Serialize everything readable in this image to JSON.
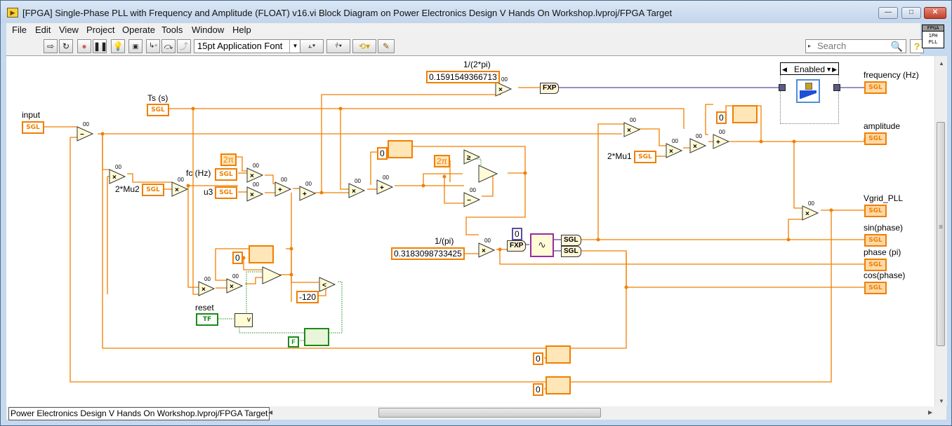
{
  "window": {
    "title": "[FPGA] Single-Phase PLL with Frequency and Amplitude (FLOAT) v16.vi Block Diagram on Power Electronics Design V Hands On Workshop.lvproj/FPGA Target",
    "buttons": {
      "minimize": "—",
      "maximize": "□",
      "close": "✕"
    }
  },
  "menu": [
    "File",
    "Edit",
    "View",
    "Project",
    "Operate",
    "Tools",
    "Window",
    "Help"
  ],
  "toolbar": {
    "font": "15pt Application Font",
    "search_placeholder": "Search",
    "help": "?",
    "icons": [
      "run-arrow",
      "run-continuously",
      "abort",
      "pause",
      "highlight-execution",
      "retain-wire-values",
      "step-into",
      "step-over",
      "step-out",
      "align-objects",
      "distribute-objects",
      "reorder",
      "cleanup-diagram"
    ]
  },
  "vi_icon": {
    "header": "FPGA",
    "line1": "1PH",
    "line2": "PLL"
  },
  "diagram": {
    "labels": {
      "input": "input",
      "ts": "Ts (s)",
      "fc": "fc  (Hz)",
      "u3": "u3",
      "mu2": "2*Mu2",
      "mu1": "2*Mu1",
      "reset": "reset",
      "inv2pi": "1/(2*pi)",
      "invpi": "1/(pi)",
      "freq": "frequency (Hz)",
      "amplitude": "amplitude",
      "vgrid": "Vgrid_PLL",
      "sin": "sin(phase)",
      "phase": "phase (pi)",
      "cos": "cos(phase)"
    },
    "constants": {
      "inv2pi": "0.1591549366713",
      "invpi": "0.3183098733425",
      "twopi": "2π",
      "zero": "0",
      "neg120": "-120",
      "false": "F"
    },
    "terminals": {
      "sgl": "SGL",
      "tf": "TF",
      "fxp": "FXP"
    },
    "diagram_disable": "Enabled",
    "node_marker": "00"
  },
  "status": {
    "path": "Power Electronics Design V Hands On Workshop.lvproj/FPGA Target"
  }
}
